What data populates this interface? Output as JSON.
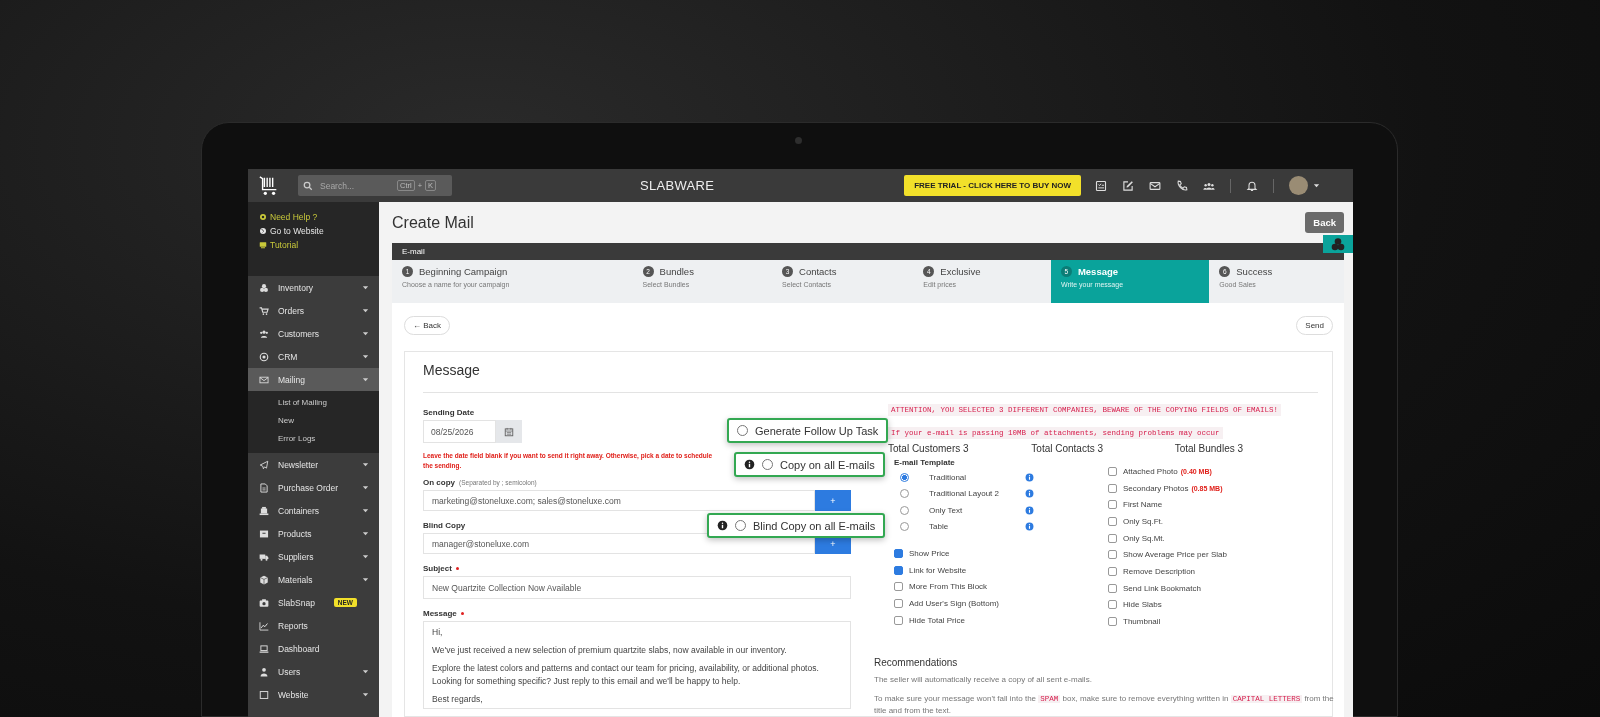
{
  "topbar": {
    "search": {
      "placeholder": "Search...",
      "keys": [
        "Ctrl",
        "+",
        "K"
      ]
    },
    "brand": "SLABWARE",
    "trial_button": "FREE TRIAL - CLICK HERE TO BUY NOW"
  },
  "sidebar": {
    "help_links": [
      {
        "label": "Need Help ?",
        "color": "#c9c93a"
      },
      {
        "label": "Go to Website",
        "color": "#e6e6e6"
      },
      {
        "label": "Tutorial",
        "color": "#c9c93a"
      }
    ],
    "items": [
      {
        "label": "Inventory",
        "submenu": true,
        "expanded": false,
        "selected": false
      },
      {
        "label": "Orders",
        "submenu": true,
        "expanded": false,
        "selected": false
      },
      {
        "label": "Customers",
        "submenu": true,
        "expanded": false,
        "selected": false
      },
      {
        "label": "CRM",
        "submenu": true,
        "expanded": false,
        "selected": false
      },
      {
        "label": "Mailing",
        "submenu": true,
        "expanded": true,
        "selected": true,
        "children": [
          {
            "label": "List of Mailing"
          },
          {
            "label": "New"
          },
          {
            "label": "Error Logs"
          }
        ]
      },
      {
        "label": "Newsletter",
        "submenu": true,
        "expanded": false,
        "selected": false
      },
      {
        "label": "Purchase Order",
        "submenu": true,
        "expanded": false,
        "selected": false
      },
      {
        "label": "Containers",
        "submenu": true,
        "expanded": false,
        "selected": false
      },
      {
        "label": "Products",
        "submenu": true,
        "expanded": false,
        "selected": false
      },
      {
        "label": "Suppliers",
        "submenu": true,
        "expanded": false,
        "selected": false
      },
      {
        "label": "Materials",
        "submenu": true,
        "expanded": false,
        "selected": false
      },
      {
        "label": "SlabSnap",
        "submenu": false,
        "expanded": false,
        "selected": false,
        "badge": "NEW"
      },
      {
        "label": "Reports",
        "submenu": false,
        "expanded": false,
        "selected": false
      },
      {
        "label": "Dashboard",
        "submenu": false,
        "expanded": false,
        "selected": false
      },
      {
        "label": "Users",
        "submenu": true,
        "expanded": false,
        "selected": false
      },
      {
        "label": "Website",
        "submenu": true,
        "expanded": false,
        "selected": false
      }
    ]
  },
  "page": {
    "title": "Create Mail",
    "back_button": "Back",
    "section_bar": "E-mail",
    "steps": [
      {
        "number": "1",
        "title": "Beginning Campaign",
        "subtitle": "Choose a name for your campaign",
        "selected": false
      },
      {
        "number": "2",
        "title": "Bundles",
        "subtitle": "Select Bundles",
        "selected": false
      },
      {
        "number": "3",
        "title": "Contacts",
        "subtitle": "Select Contacts",
        "selected": false
      },
      {
        "number": "4",
        "title": "Exclusive",
        "subtitle": "Edit prices",
        "selected": false
      },
      {
        "number": "5",
        "title": "Message",
        "subtitle": "Write your message",
        "selected": true
      },
      {
        "number": "6",
        "title": "Success",
        "subtitle": "Good Sales",
        "selected": false
      }
    ],
    "nav_back": "← Back",
    "nav_send": "Send"
  },
  "message_card": {
    "title": "Message",
    "sending_date": {
      "label": "Sending Date",
      "value": "08/25/2026"
    },
    "date_hint": "Leave the date field blank if you want to send it right away. Otherwise, pick a date to schedule the sending.",
    "on_copy": {
      "label": "On copy",
      "note": "(Separated by ; semicolon)",
      "value": "marketing@stoneluxe.com; sales@stoneluxe.com",
      "button": "+"
    },
    "blind_copy": {
      "label": "Blind Copy",
      "value": "manager@stoneluxe.com",
      "button": "+"
    },
    "subject": {
      "label": "Subject",
      "required": true,
      "value": "New Quartzite Collection Now Available"
    },
    "message": {
      "label": "Message",
      "required": true,
      "paragraphs": [
        [
          "Hi,"
        ],
        [
          "We've just received a new selection of premium quartzite slabs, now available in our inventory."
        ],
        [
          "Explore the latest colors and patterns and contact our team for pricing, availability, or additional photos.",
          "Looking for something specific? Just reply to this email and we'll be happy to help."
        ],
        [
          "Best regards,"
        ]
      ]
    },
    "callouts": [
      {
        "label": "Generate Follow Up Task",
        "checked": false,
        "info": false
      },
      {
        "label": "Copy on all E-mails",
        "checked": false,
        "info": true
      },
      {
        "label": "Blind Copy on all E-mails",
        "checked": false,
        "info": true
      }
    ],
    "warnings": [
      "ATTENTION, YOU SELECTED 3 DIFFERENT COMPANIES, BEWARE OF THE COPYING FIELDS OF EMAILS!",
      "If your e-mail is passing 10MB of attachments, sending problems may occur"
    ],
    "totals": [
      "Total Customers 3",
      "Total Contacts 3",
      "Total Bundles 3"
    ],
    "template": {
      "label": "E-mail Template",
      "options": [
        {
          "label": "Traditional",
          "selected": true
        },
        {
          "label": "Traditional Layout 2",
          "selected": false
        },
        {
          "label": "Only Text",
          "selected": false
        },
        {
          "label": "Table",
          "selected": false
        }
      ]
    },
    "options_left": [
      {
        "label": "Show Price",
        "checked": true
      },
      {
        "label": "Link for Website",
        "checked": true
      },
      {
        "label": "More From This Block",
        "checked": false
      },
      {
        "label": "Add User's Sign (Bottom)",
        "checked": false
      },
      {
        "label": "Hide Total Price",
        "checked": false
      }
    ],
    "options_right": [
      {
        "label": "Attached Photo",
        "checked": false,
        "size": "(0.40 MB)"
      },
      {
        "label": "Secondary Photos",
        "checked": false,
        "size": "(0.85 MB)"
      },
      {
        "label": "First Name",
        "checked": false
      },
      {
        "label": "Only Sq.Ft.",
        "checked": false
      },
      {
        "label": "Only Sq.Mt.",
        "checked": false
      },
      {
        "label": "Show Average Price per Slab",
        "checked": false
      },
      {
        "label": "Remove Description",
        "checked": false
      },
      {
        "label": "Send Link Bookmatch",
        "checked": false
      },
      {
        "label": "Hide Slabs",
        "checked": false
      },
      {
        "label": "Thumbnail",
        "checked": false
      }
    ],
    "recommendations": {
      "title": "Recommendations",
      "text": "The seller will automatically receive a copy of all sent e-mails.",
      "parts": [
        {
          "kind": "text",
          "text": "To make sure your message won't fall into the"
        },
        {
          "kind": "code",
          "text": "SPAM"
        },
        {
          "kind": "text",
          "text": "box, make sure to remove everything written in"
        },
        {
          "kind": "code",
          "text": "CAPITAL LETTERS"
        },
        {
          "kind": "text",
          "text": "from the title and from the text."
        }
      ]
    }
  }
}
